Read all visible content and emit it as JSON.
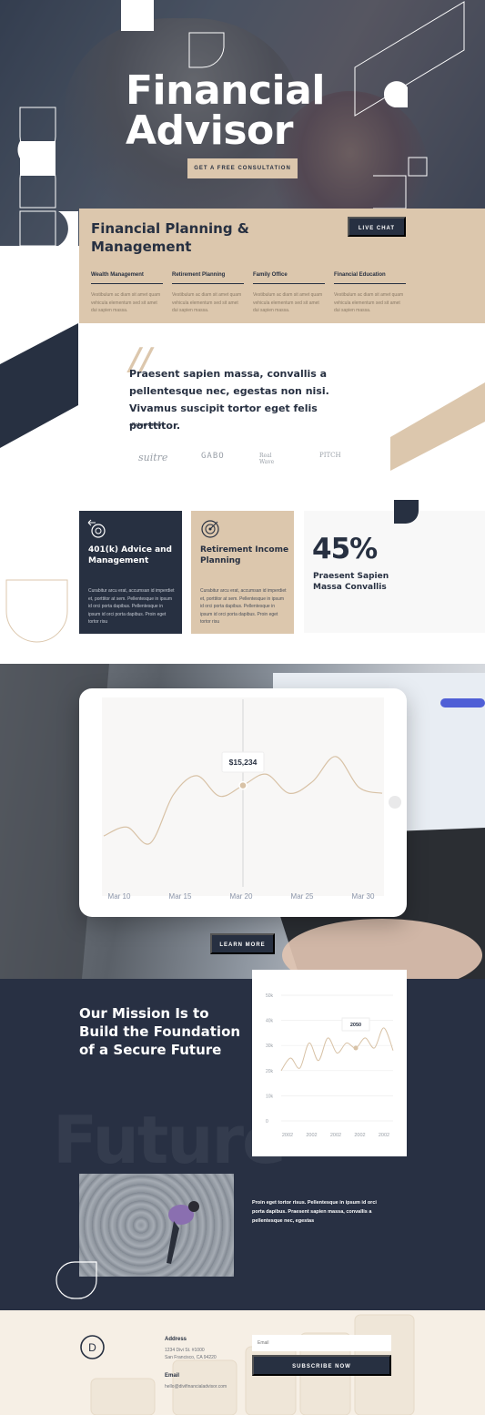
{
  "hero": {
    "title": "Financial Advisor",
    "cta_label": "GET A FREE CONSULTATION"
  },
  "planning": {
    "title": "Financial Planning & Management",
    "chat_label": "LIVE CHAT",
    "columns": [
      {
        "heading": "Wealth Management",
        "text": "Vestibulum ac diam sit amet quam vehicula elementum sed sit amet dui sapien massa."
      },
      {
        "heading": "Retirement Planning",
        "text": "Vestibulum ac diam sit amet quam vehicula elementum sed sit amet dui sapien massa."
      },
      {
        "heading": "Family Office",
        "text": "Vestibulum ac diam sit amet quam vehicula elementum sed sit amet dui sapien massa."
      },
      {
        "heading": "Financial Education",
        "text": "Vestibulum ac diam sit amet quam vehicula elementum sed sit amet dui sapien massa."
      }
    ]
  },
  "testimonial": {
    "quote": "Praesent sapien massa, convallis a pellentesque nec, egestas non nisi. Vivamus suscipit tortor eget felis porttitor.",
    "author": "- Robert Jomon",
    "logos": [
      "suitre",
      "GABO",
      "Real Wave",
      "PITCH"
    ]
  },
  "services": [
    {
      "title": "401(k) Advice and Management",
      "icon": "hand-coin-icon",
      "text": "Curabitur arcu erat, accumsan id imperdiet et, porttitor at sem. Pellentesque in ipsum id orci porta dapibus. Pellentesque in ipsum id orci porta dapibus. Proin eget tortor risu"
    },
    {
      "title": "Retirement Income Planning",
      "icon": "target-icon",
      "text": "Curabitur arcu erat, accumsan id imperdiet et, porttitor at sem. Pellentesque in ipsum id orci porta dapibus. Pellentesque in ipsum id orci porta dapibus. Proin eget tortor risu"
    }
  ],
  "stat": {
    "value": "45%",
    "label": "Praesent Sapien Massa Convallis"
  },
  "chart_data": [
    {
      "type": "line",
      "tooltip": "$15,234",
      "x_labels": [
        "Mar 10",
        "Mar 15",
        "Mar 20",
        "Mar 25",
        "Mar 30"
      ],
      "x": [
        7,
        9,
        11,
        13,
        15,
        17,
        19,
        21,
        23,
        25,
        27,
        29,
        31
      ],
      "values": [
        11800,
        12400,
        11300,
        14600,
        15900,
        14500,
        15234,
        16000,
        14700,
        15500,
        17200,
        15100,
        14700
      ],
      "highlight_index": 6,
      "colors": {
        "line": "#d8c2a6",
        "bg": "#f8f7f6"
      }
    },
    {
      "type": "line",
      "tooltip": "2050",
      "y_ticks": [
        "50k",
        "40k",
        "30k",
        "20k",
        "10k",
        "0"
      ],
      "ylim": [
        0,
        50
      ],
      "x_labels": [
        "2002",
        "2002",
        "2002",
        "2002",
        "2002"
      ],
      "values": [
        20,
        25,
        21,
        31,
        24,
        33,
        27,
        31,
        29,
        33,
        29,
        37,
        28
      ],
      "highlight_index": 8,
      "colors": {
        "line": "#d8c2a6"
      }
    }
  ],
  "learn_more_label": "LEARN MORE",
  "mission": {
    "title": "Our Mission Is to Build the Foundation of a Secure Future",
    "bg_word": "Future",
    "paragraph": "Proin eget tortor risus. Pellentesque in ipsum id orci porta dapibus. Praesent sapien massa, convallis a pellentesque nec, egestas"
  },
  "footer": {
    "logo_letter": "D",
    "address_heading": "Address",
    "address_line1": "1234 Divi St. #1000",
    "address_line2": "San Francisco, CA 94220",
    "email_heading": "Email",
    "email_value": "hello@divifinancialadvisor.com",
    "email_placeholder": "Email",
    "subscribe_label": "SUBSCRIBE NOW"
  },
  "colors": {
    "navy": "#273041",
    "sand": "#dcc7ad",
    "cream": "#f6efe5"
  }
}
